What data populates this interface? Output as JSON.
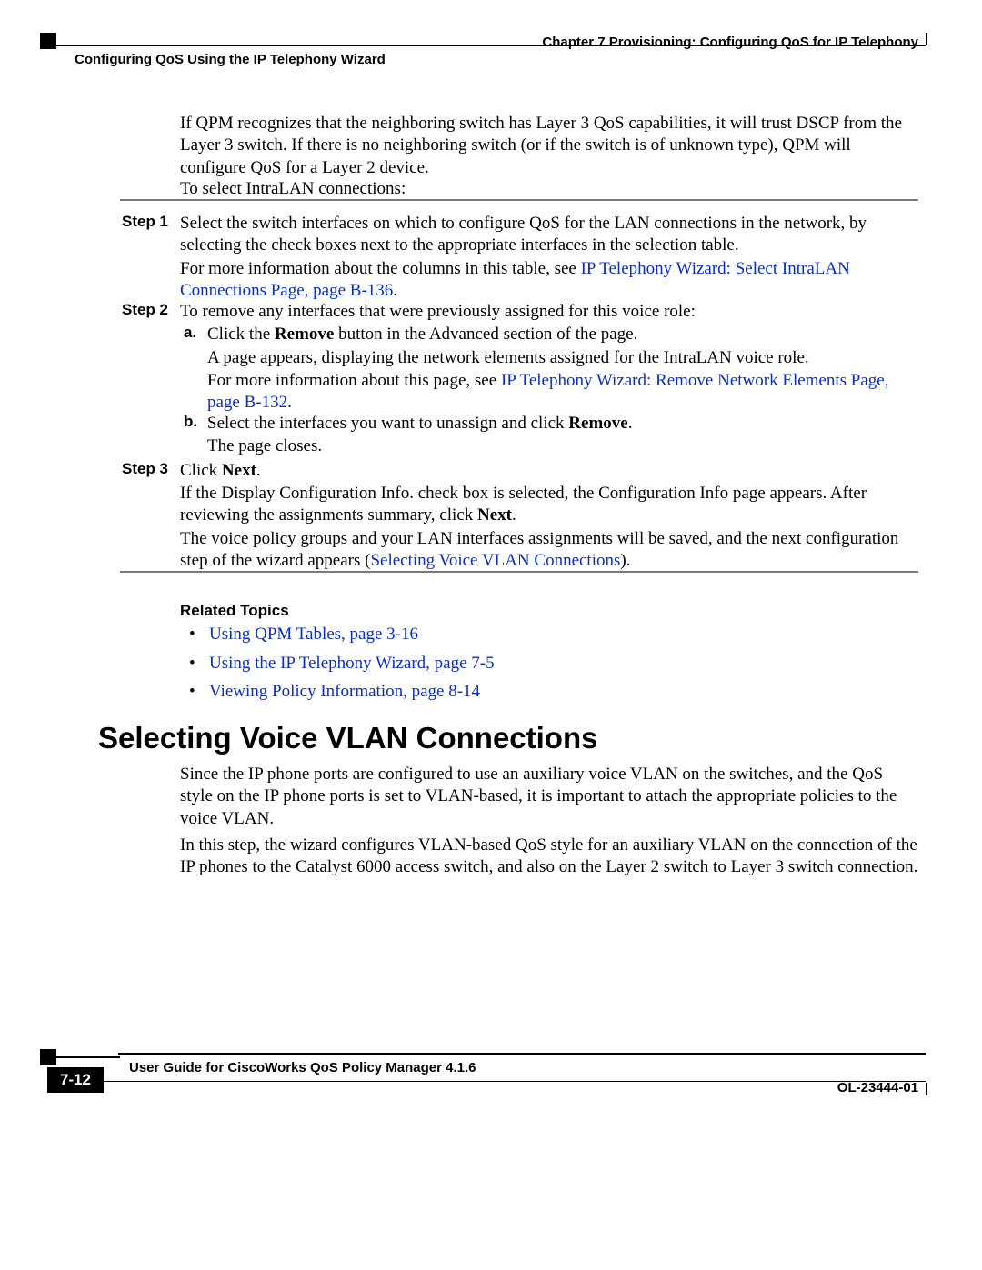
{
  "header": {
    "chapter": "Chapter 7      Provisioning: Configuring QoS for IP Telephony",
    "section": "Configuring QoS Using the IP Telephony Wizard"
  },
  "intro": {
    "p1": "If QPM recognizes that the neighboring switch has Layer 3 QoS capabilities, it will trust DSCP from the Layer 3 switch. If there is no neighboring switch (or if the switch is of unknown type), QPM will configure QoS for a Layer 2 device.",
    "p2": "To select IntraLAN connections:"
  },
  "steps": {
    "s1": {
      "label": "Step 1",
      "p1": "Select the switch interfaces on which to configure QoS for the LAN connections in the network, by selecting the check boxes next to the appropriate interfaces in the selection table.",
      "p2a": "For more information about the columns in this table, see ",
      "p2link": "IP Telephony Wizard: Select IntraLAN Connections Page, page B-136",
      "p2b": "."
    },
    "s2": {
      "label": "Step 2",
      "p1": "To remove any interfaces that were previously assigned for this voice role:",
      "a_lbl": "a.",
      "a1a": "Click the ",
      "a1b": "Remove",
      "a1c": " button in the Advanced section of the page.",
      "a2": "A page appears, displaying the network elements assigned for the IntraLAN voice role.",
      "a3a": "For more information about this page, see ",
      "a3link": "IP Telephony Wizard: Remove Network Elements Page, page B-132",
      "a3b": ".",
      "b_lbl": "b.",
      "b1a": "Select the interfaces you want to unassign and click ",
      "b1b": "Remove",
      "b1c": ".",
      "b2": "The page closes."
    },
    "s3": {
      "label": "Step 3",
      "p1a": "Click ",
      "p1b": "Next",
      "p1c": ".",
      "p2a": "If the Display Configuration Info. check box is selected, the Configuration Info page appears. After reviewing the assignments summary, click ",
      "p2b": "Next",
      "p2c": ".",
      "p3a": "The voice policy groups and your LAN interfaces assignments will be saved, and the next configuration step of the wizard appears (",
      "p3link": "Selecting Voice VLAN Connections",
      "p3b": ")."
    }
  },
  "related": {
    "heading": "Related Topics",
    "items": [
      "Using QPM Tables, page 3-16",
      "Using the IP Telephony Wizard, page 7-5",
      "Viewing Policy Information, page 8-14"
    ]
  },
  "h2": "Selecting Voice VLAN Connections",
  "vlan": {
    "p1": "Since the IP phone ports are configured to use an auxiliary voice VLAN on the switches, and the QoS style on the IP phone ports is set to VLAN-based, it is important to attach the appropriate policies to the voice VLAN.",
    "p2": "In this step, the wizard configures VLAN-based QoS style for an auxiliary VLAN on the connection of the IP phones to the Catalyst 6000 access switch, and also on the Layer 2 switch to Layer 3 switch connection."
  },
  "footer": {
    "book": "User Guide for CiscoWorks QoS Policy Manager 4.1.6",
    "page": "7-12",
    "docid": "OL-23444-01"
  }
}
